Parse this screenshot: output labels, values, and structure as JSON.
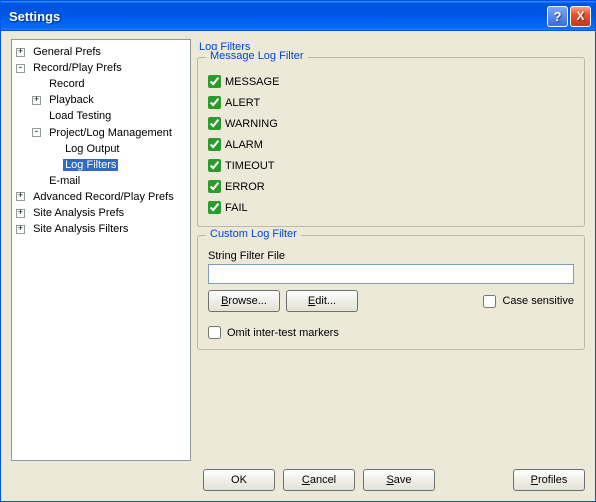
{
  "window": {
    "title": "Settings"
  },
  "titlebar_buttons": {
    "help": "?",
    "close": "X"
  },
  "tree": {
    "general_prefs": "General Prefs",
    "record_play_prefs": "Record/Play Prefs",
    "record": "Record",
    "playback": "Playback",
    "load_testing": "Load Testing",
    "proj_log_mgmt": "Project/Log Management",
    "log_output": "Log Output",
    "log_filters": "Log Filters",
    "email": "E-mail",
    "adv_record_play": "Advanced Record/Play Prefs",
    "site_analysis_prefs": "Site Analysis Prefs",
    "site_analysis_filters": "Site Analysis Filters"
  },
  "page": {
    "title": "Log Filters",
    "message_filter": {
      "legend": "Message Log Filter",
      "items": [
        "MESSAGE",
        "ALERT",
        "WARNING",
        "ALARM",
        "TIMEOUT",
        "ERROR",
        "FAIL"
      ]
    },
    "custom_filter": {
      "legend": "Custom Log Filter",
      "file_label": "String Filter File",
      "file_value": "",
      "browse": "Browse...",
      "edit": "Edit...",
      "case_sensitive": "Case sensitive",
      "omit_markers": "Omit inter-test markers"
    }
  },
  "buttons": {
    "ok": "OK",
    "cancel": "Cancel",
    "save": "Save",
    "profiles": "Profiles"
  },
  "expander": {
    "plus": "+",
    "minus": "-"
  }
}
